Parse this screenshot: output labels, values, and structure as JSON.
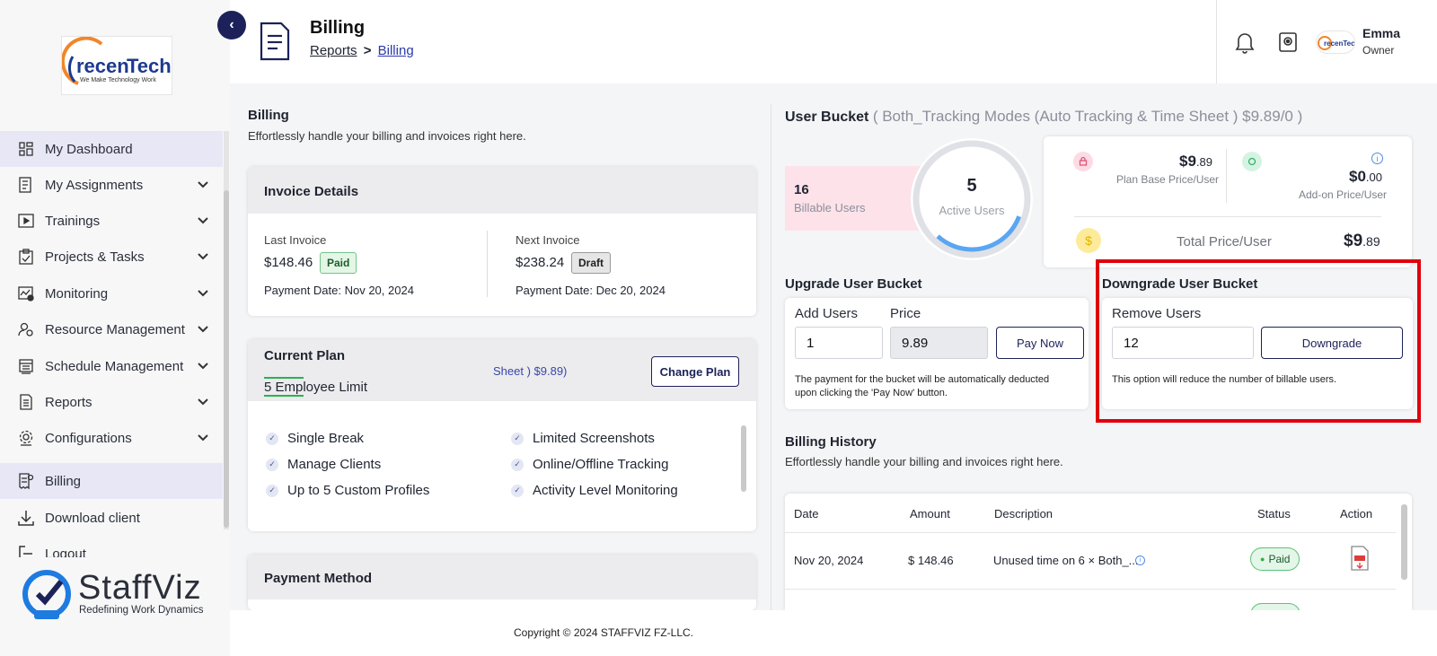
{
  "brand": {
    "logo_text": "recenTech",
    "logo_tagline": "We Make Technology Work",
    "footer_logo_text": "StaffViz",
    "footer_logo_tagline": "Redefining Work Dynamics",
    "accent_color": "#1c2259",
    "active_nav_bg": "#e7e7f6"
  },
  "sidebar": {
    "items": [
      {
        "label": "My Dashboard",
        "icon": "dashboard-icon"
      },
      {
        "label": "My Assignments",
        "icon": "assignment-icon"
      },
      {
        "label": "Trainings",
        "icon": "training-icon"
      },
      {
        "label": "Projects & Tasks",
        "icon": "clipboard-icon"
      },
      {
        "label": "Monitoring",
        "icon": "monitoring-icon"
      },
      {
        "label": "Resource Management",
        "icon": "user-gear-icon"
      },
      {
        "label": "Schedule Management",
        "icon": "calendar-icon"
      },
      {
        "label": "Reports",
        "icon": "report-icon"
      },
      {
        "label": "Configurations",
        "icon": "config-icon"
      },
      {
        "label": "Billing",
        "icon": "billing-icon"
      },
      {
        "label": "Download client",
        "icon": "download-icon"
      },
      {
        "label": "Logout",
        "icon": "logout-icon"
      }
    ]
  },
  "header": {
    "title": "Billing",
    "breadcrumb_parent": "Reports",
    "breadcrumb_sep": ">",
    "breadcrumb_current": "Billing",
    "user_name": "Emma",
    "user_role": "Owner"
  },
  "billing_intro": {
    "title": "Billing",
    "subtitle": "Effortlessly handle your billing and invoices right here."
  },
  "invoice": {
    "title": "Invoice Details",
    "last_label": "Last Invoice",
    "last_amount": "$148.46",
    "last_status": "Paid",
    "last_date": "Payment Date: Nov 20, 2024",
    "next_label": "Next Invoice",
    "next_amount": "$238.24",
    "next_status": "Draft",
    "next_date": "Payment Date: Dec 20, 2024"
  },
  "current_plan": {
    "title": "Current Plan",
    "employee_limit": "5 Employee Limit",
    "plan_tail": "Sheet ) $9.89)",
    "change_button": "Change Plan",
    "features_left": [
      "Single Break",
      "Manage Clients",
      "Up to 5 Custom Profiles"
    ],
    "features_right": [
      "Limited Screenshots",
      "Online/Offline Tracking",
      "Activity Level Monitoring"
    ]
  },
  "payment_method": {
    "title": "Payment Method"
  },
  "user_bucket": {
    "title": "User Bucket",
    "detail": "( Both_Tracking Modes (Auto Tracking & Time Sheet ) $9.89/0 )",
    "billable_count": "16",
    "billable_label": "Billable Users",
    "active_count": "5",
    "active_label": "Active Users",
    "active_fraction": 0.3125,
    "plan_price_main": "$9",
    "plan_price_cents": ".89",
    "plan_price_label": "Plan Base Price/User",
    "addon_price_main": "$0",
    "addon_price_cents": ".00",
    "addon_price_label": "Add-on Price/User",
    "total_label": "Total Price/User",
    "total_main": "$9",
    "total_cents": ".89"
  },
  "upgrade": {
    "title": "Upgrade User Bucket",
    "add_users_label": "Add Users",
    "add_users_value": "1",
    "price_label": "Price",
    "price_value": "9.89",
    "pay_button": "Pay Now",
    "note": "The payment for the bucket will be automatically deducted upon clicking the 'Pay Now' button."
  },
  "downgrade": {
    "title": "Downgrade User Bucket",
    "remove_label": "Remove Users",
    "remove_value": "12",
    "button": "Downgrade",
    "note": "This option will reduce the number of billable users.",
    "highlight_color": "#e0000d"
  },
  "billing_history": {
    "title": "Billing History",
    "subtitle": "Effortlessly handle your billing and invoices right here.",
    "columns": [
      "Date",
      "Amount",
      "Description",
      "Status",
      "Action"
    ],
    "rows": [
      {
        "date": "Nov 20, 2024",
        "amount": "$ 148.46",
        "description": "Unused time on 6 × Both_...",
        "status": "Paid"
      }
    ]
  },
  "footer": {
    "copyright": "Copyright © 2024 STAFFVIZ FZ-LLC."
  }
}
